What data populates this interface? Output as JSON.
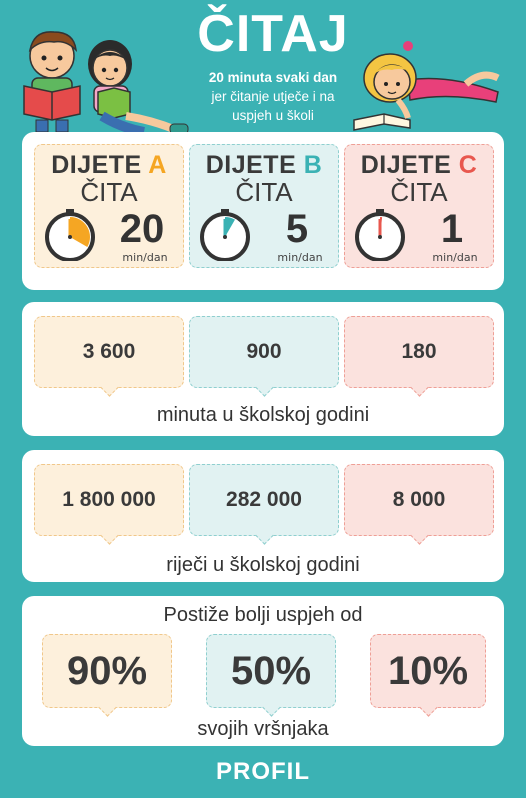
{
  "header": {
    "title": "ČITAJ",
    "subtitle_bold": "20 minuta svaki dan",
    "subtitle_line2": "jer čitanje utječe i na",
    "subtitle_line3": "uspjeh u školi"
  },
  "kids": [
    {
      "name_word": "DIJETE",
      "name_letter": "A",
      "reads": "ČITA",
      "minutes": "20",
      "unit": "min/dan",
      "letter_color": "#f5a623",
      "clock_fill_fraction": 0.333
    },
    {
      "name_word": "DIJETE",
      "name_letter": "B",
      "reads": "ČITA",
      "minutes": "5",
      "unit": "min/dan",
      "letter_color": "#3bb2b4",
      "clock_fill_fraction": 0.083
    },
    {
      "name_word": "DIJETE",
      "name_letter": "C",
      "reads": "ČITA",
      "minutes": "1",
      "unit": "min/dan",
      "letter_color": "#e8574e",
      "clock_fill_fraction": 0.017
    }
  ],
  "minutes_year": {
    "values": [
      "3 600",
      "900",
      "180"
    ],
    "caption": "minuta u školskoj godini"
  },
  "words_year": {
    "values": [
      "1 800 000",
      "282 000",
      "8 000"
    ],
    "caption": "riječi u školskoj godini"
  },
  "success": {
    "heading": "Postiže bolji uspjeh od",
    "values": [
      "90%",
      "50%",
      "10%"
    ],
    "caption": "svojih vršnjaka"
  },
  "footer": {
    "brand": "PROFIL"
  }
}
